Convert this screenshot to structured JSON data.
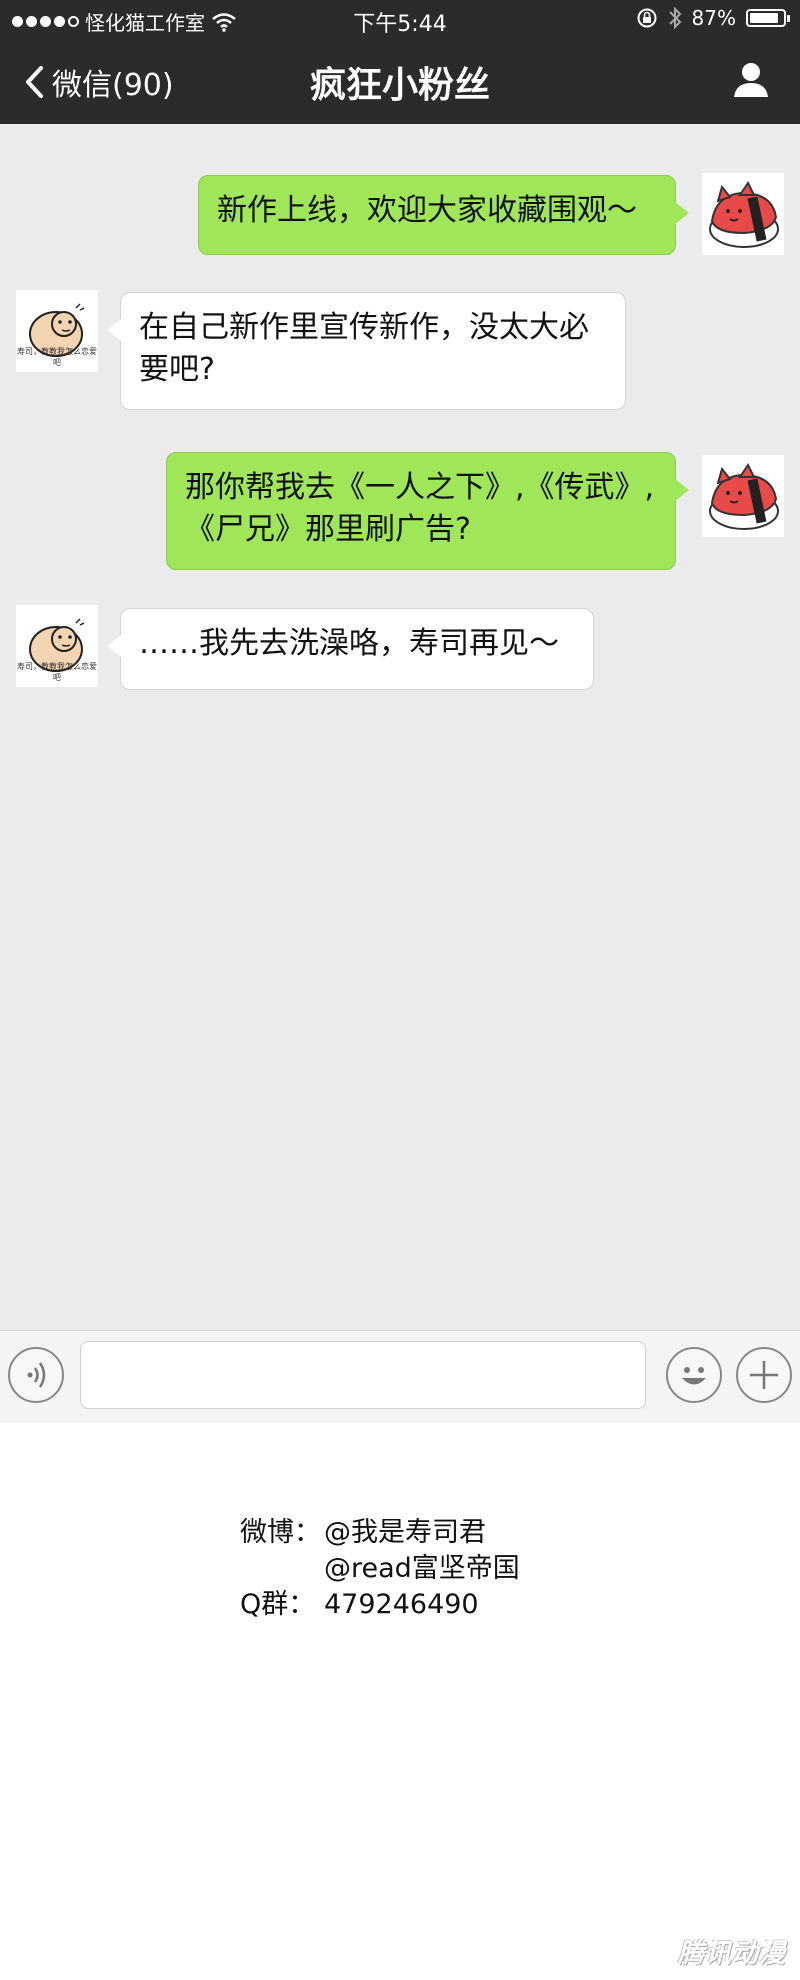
{
  "status_bar": {
    "carrier": "怪化猫工作室",
    "time": "下午5:44",
    "battery": "87%",
    "battery_level": 0.87,
    "icons": [
      "signal-dots-icon",
      "wifi-icon",
      "rotation-lock-icon",
      "bluetooth-icon",
      "battery-icon"
    ]
  },
  "nav": {
    "back_label": "微信(90)",
    "title": "疯狂小粉丝",
    "icons": [
      "chevron-left-icon",
      "person-icon"
    ]
  },
  "messages": [
    {
      "sender": "me",
      "lines": [
        "新作上线，欢迎大家收藏围观～"
      ]
    },
    {
      "sender": "other",
      "lines": [
        "在自己新作里宣传新作，没太大必",
        "要吧?"
      ]
    },
    {
      "sender": "me",
      "lines": [
        "那你帮我去《一人之下》,《传武》,",
        "《尸兄》那里刷广告?"
      ]
    },
    {
      "sender": "other",
      "lines": [
        "……我先去洗澡咯，寿司再见～"
      ]
    }
  ],
  "avatars": {
    "me": "sushi-cat-avatar",
    "other": "blob-character-avatar",
    "other_caption": "寿司，教教我怎么恋爱吧"
  },
  "input_bar": {
    "icons": [
      "voice-icon",
      "emoji-icon",
      "plus-icon"
    ],
    "input_value": ""
  },
  "credits": {
    "weibo_label": "微博：",
    "weibo_1": "@我是寿司君",
    "weibo_2": "@read富坚帝国",
    "qq_label": "Q群：",
    "qq_value": "479246490"
  },
  "watermark": "腾讯动漫",
  "colors": {
    "nav_bg": "#2b2b2b",
    "chat_bg": "#ebebeb",
    "me_bubble": "#9fe658",
    "other_bubble": "#ffffff"
  }
}
